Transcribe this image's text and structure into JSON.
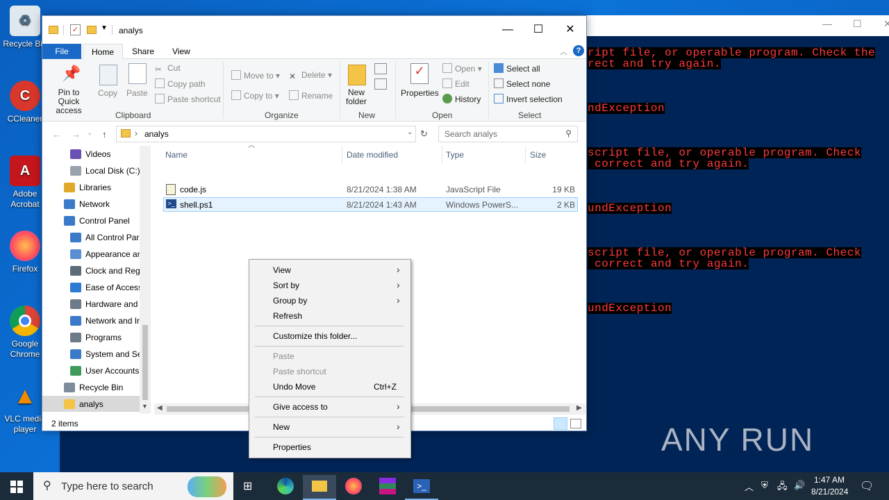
{
  "desktop": {
    "icons": [
      {
        "label": "Recycle Bin",
        "name": "recycle-bin-icon"
      },
      {
        "label": "CCleaner",
        "name": "ccleaner-icon"
      },
      {
        "label": "Adobe Acrobat",
        "name": "adobe-acrobat-icon"
      },
      {
        "label": "Firefox",
        "name": "firefox-icon"
      },
      {
        "label": "Google Chrome",
        "name": "google-chrome-icon"
      },
      {
        "label": "VLC media player",
        "name": "vlc-icon"
      }
    ]
  },
  "powershell": {
    "lines": [
      "ript file, or operable program. Check the",
      "rect and try again.",
      "ndException",
      "script file, or operable program. Check",
      " correct and try again.",
      "undException",
      "script file, or operable program. Check",
      " correct and try again.",
      "undException"
    ],
    "watermark": "ANY RUN"
  },
  "explorer": {
    "title": "analys",
    "tabs": {
      "file": "File",
      "home": "Home",
      "share": "Share",
      "view": "View"
    },
    "ribbon": {
      "pin": "Pin to Quick access",
      "copy": "Copy",
      "paste": "Paste",
      "cut": "Cut",
      "copy_path": "Copy path",
      "paste_shortcut": "Paste shortcut",
      "clipboard": "Clipboard",
      "move_to": "Move to",
      "copy_to": "Copy to",
      "delete": "Delete",
      "rename": "Rename",
      "organize": "Organize",
      "new_folder": "New folder",
      "new": "New",
      "properties": "Properties",
      "open": "Open",
      "edit": "Edit",
      "history": "History",
      "open_group": "Open",
      "select_all": "Select all",
      "select_none": "Select none",
      "invert_selection": "Invert selection",
      "select": "Select"
    },
    "address": {
      "path": "analys",
      "search_placeholder": "Search analys"
    },
    "nav": [
      {
        "label": "Videos",
        "indent": 1,
        "color": "#6a4fb5"
      },
      {
        "label": "Local Disk (C:)",
        "indent": 1,
        "color": "#9aa3ad"
      },
      {
        "label": "Libraries",
        "indent": 0,
        "color": "#e0a92a"
      },
      {
        "label": "Network",
        "indent": 0,
        "color": "#3b79c9"
      },
      {
        "label": "Control Panel",
        "indent": 0,
        "color": "#3b79c9"
      },
      {
        "label": "All Control Par",
        "indent": 1,
        "color": "#3b79c9"
      },
      {
        "label": "Appearance an",
        "indent": 1,
        "color": "#5a8fd6"
      },
      {
        "label": "Clock and Regi",
        "indent": 1,
        "color": "#5c6b7a"
      },
      {
        "label": "Ease of Access",
        "indent": 1,
        "color": "#2d7ad1"
      },
      {
        "label": "Hardware and",
        "indent": 1,
        "color": "#6d7b88"
      },
      {
        "label": "Network and Ir",
        "indent": 1,
        "color": "#3b79c9"
      },
      {
        "label": "Programs",
        "indent": 1,
        "color": "#6d7b88"
      },
      {
        "label": "System and Sec",
        "indent": 1,
        "color": "#3b79c9"
      },
      {
        "label": "User Accounts",
        "indent": 1,
        "color": "#3f9b5a"
      },
      {
        "label": "Recycle Bin",
        "indent": 0,
        "color": "#7c8c9c"
      },
      {
        "label": "analys",
        "indent": 0,
        "color": "#f3c445",
        "selected": true
      }
    ],
    "columns": {
      "name": "Name",
      "date": "Date modified",
      "type": "Type",
      "size": "Size"
    },
    "files": [
      {
        "name": "code.js",
        "date": "8/21/2024 1:38 AM",
        "type": "JavaScript File",
        "size": "19 KB"
      },
      {
        "name": "shell.ps1",
        "date": "8/21/2024 1:43 AM",
        "type": "Windows PowerS...",
        "size": "2 KB"
      }
    ],
    "status": "2 items"
  },
  "context_menu": {
    "view": "View",
    "sort_by": "Sort by",
    "group_by": "Group by",
    "refresh": "Refresh",
    "customize": "Customize this folder...",
    "paste": "Paste",
    "paste_shortcut": "Paste shortcut",
    "undo_move": "Undo Move",
    "undo_shortcut": "Ctrl+Z",
    "give_access": "Give access to",
    "new": "New",
    "properties": "Properties"
  },
  "taskbar": {
    "search_placeholder": "Type here to search",
    "time": "1:47 AM",
    "date": "8/21/2024"
  }
}
